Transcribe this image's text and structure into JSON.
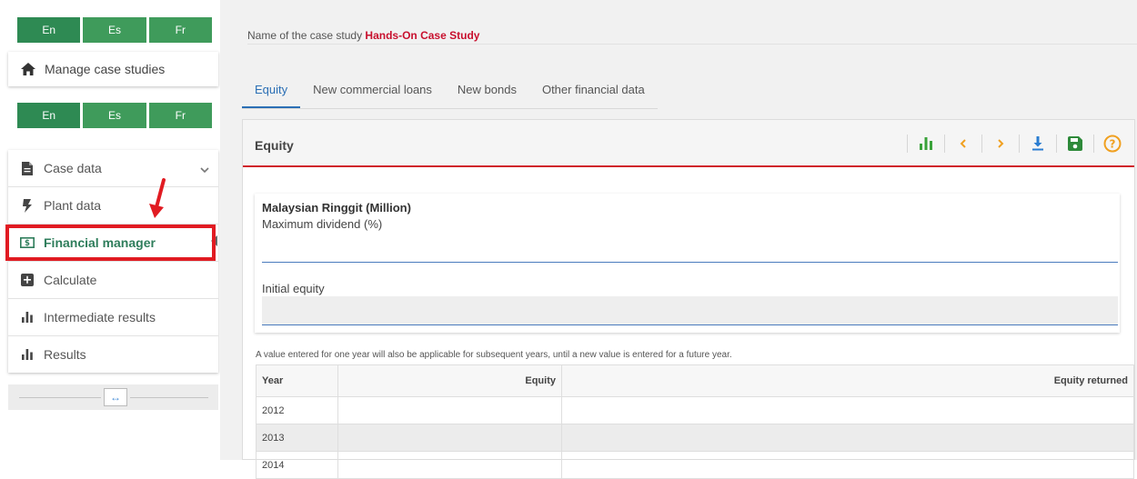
{
  "sidebar": {
    "languages_top": [
      "En",
      "Es",
      "Fr"
    ],
    "manage_case_studies": "Manage case studies",
    "languages_bottom": [
      "En",
      "Es",
      "Fr"
    ],
    "menu": [
      {
        "label": "Case data",
        "icon": "file-icon"
      },
      {
        "label": "Plant data",
        "icon": "bolt-icon"
      },
      {
        "label": "Financial manager",
        "icon": "money-icon",
        "active": true
      },
      {
        "label": "Calculate",
        "icon": "calculator-icon"
      },
      {
        "label": "Intermediate results",
        "icon": "bar-chart-icon"
      },
      {
        "label": "Results",
        "icon": "bar-chart-icon"
      }
    ],
    "collapse_label": "↔"
  },
  "header": {
    "case_prefix": "Name of the case study",
    "case_name": "Hands-On Case Study"
  },
  "tabs": [
    "Equity",
    "New commercial loans",
    "New bonds",
    "Other financial data"
  ],
  "panel": {
    "title": "Equity",
    "toolbar": [
      "chart-icon",
      "prev-icon",
      "next-icon",
      "download-icon",
      "save-icon",
      "help-icon"
    ],
    "currency": "Malaysian Ringgit (Million)",
    "max_dividend_label": "Maximum dividend (%)",
    "max_dividend_value": "",
    "initial_equity_label": "Initial equity",
    "initial_equity_value": "",
    "note": "A value entered for one year will also be applicable for subsequent years, until a new value is entered for a future year.",
    "table": {
      "headers": [
        "Year",
        "Equity",
        "Equity returned"
      ],
      "rows": [
        {
          "year": "2012",
          "equity": "",
          "returned": ""
        },
        {
          "year": "2013",
          "equity": "",
          "returned": ""
        },
        {
          "year": "2014",
          "equity": "",
          "returned": ""
        }
      ]
    }
  },
  "colors": {
    "lang_green": "#3f9b5b",
    "highlight_red": "#e11b22",
    "case_name_red": "#c8102e",
    "tab_blue": "#2b6fb5",
    "toolbar_green": "#3aa23a",
    "toolbar_orange": "#f0a020",
    "toolbar_blue": "#2a7dd1"
  }
}
